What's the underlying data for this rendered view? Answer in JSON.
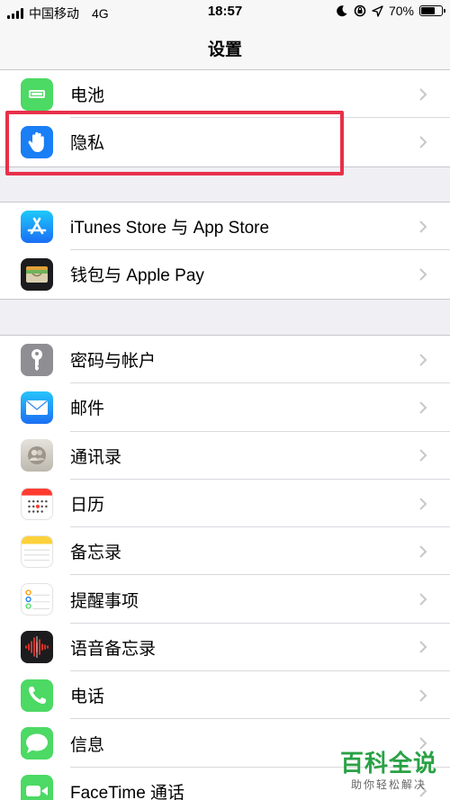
{
  "status_bar": {
    "carrier": "中国移动",
    "network": "4G",
    "time": "18:57",
    "battery_percent": "70%",
    "battery_level": 0.7
  },
  "nav": {
    "title": "设置"
  },
  "groups": [
    {
      "items": [
        {
          "label": "电池",
          "icon": "battery-icon",
          "color": "#4cd964"
        },
        {
          "label": "隐私",
          "icon": "hand-icon",
          "color": "#1a7ef5"
        }
      ]
    },
    {
      "items": [
        {
          "label": "iTunes Store 与 App Store",
          "icon": "app-store-icon",
          "color": "#1a82fb"
        },
        {
          "label": "钱包与 Apple Pay",
          "icon": "wallet-icon",
          "color": "#1c1c1e"
        }
      ]
    },
    {
      "items": [
        {
          "label": "密码与帐户",
          "icon": "key-icon",
          "color": "#8e8e93"
        },
        {
          "label": "邮件",
          "icon": "mail-icon",
          "color": "#2a8df5"
        },
        {
          "label": "通讯录",
          "icon": "contacts-icon",
          "color": "#d8d4cc"
        },
        {
          "label": "日历",
          "icon": "calendar-icon",
          "color": "#ffffff"
        },
        {
          "label": "备忘录",
          "icon": "notes-icon",
          "color": "#ffffff"
        },
        {
          "label": "提醒事项",
          "icon": "reminders-icon",
          "color": "#ffffff"
        },
        {
          "label": "语音备忘录",
          "icon": "voice-memos-icon",
          "color": "#1c1c1e"
        },
        {
          "label": "电话",
          "icon": "phone-icon",
          "color": "#4cd964"
        },
        {
          "label": "信息",
          "icon": "messages-icon",
          "color": "#4cd964"
        },
        {
          "label": "FaceTime 通话",
          "icon": "facetime-icon",
          "color": "#4cd964"
        }
      ]
    }
  ],
  "watermark": {
    "main": "百科全说",
    "sub": "助你轻松解决"
  }
}
